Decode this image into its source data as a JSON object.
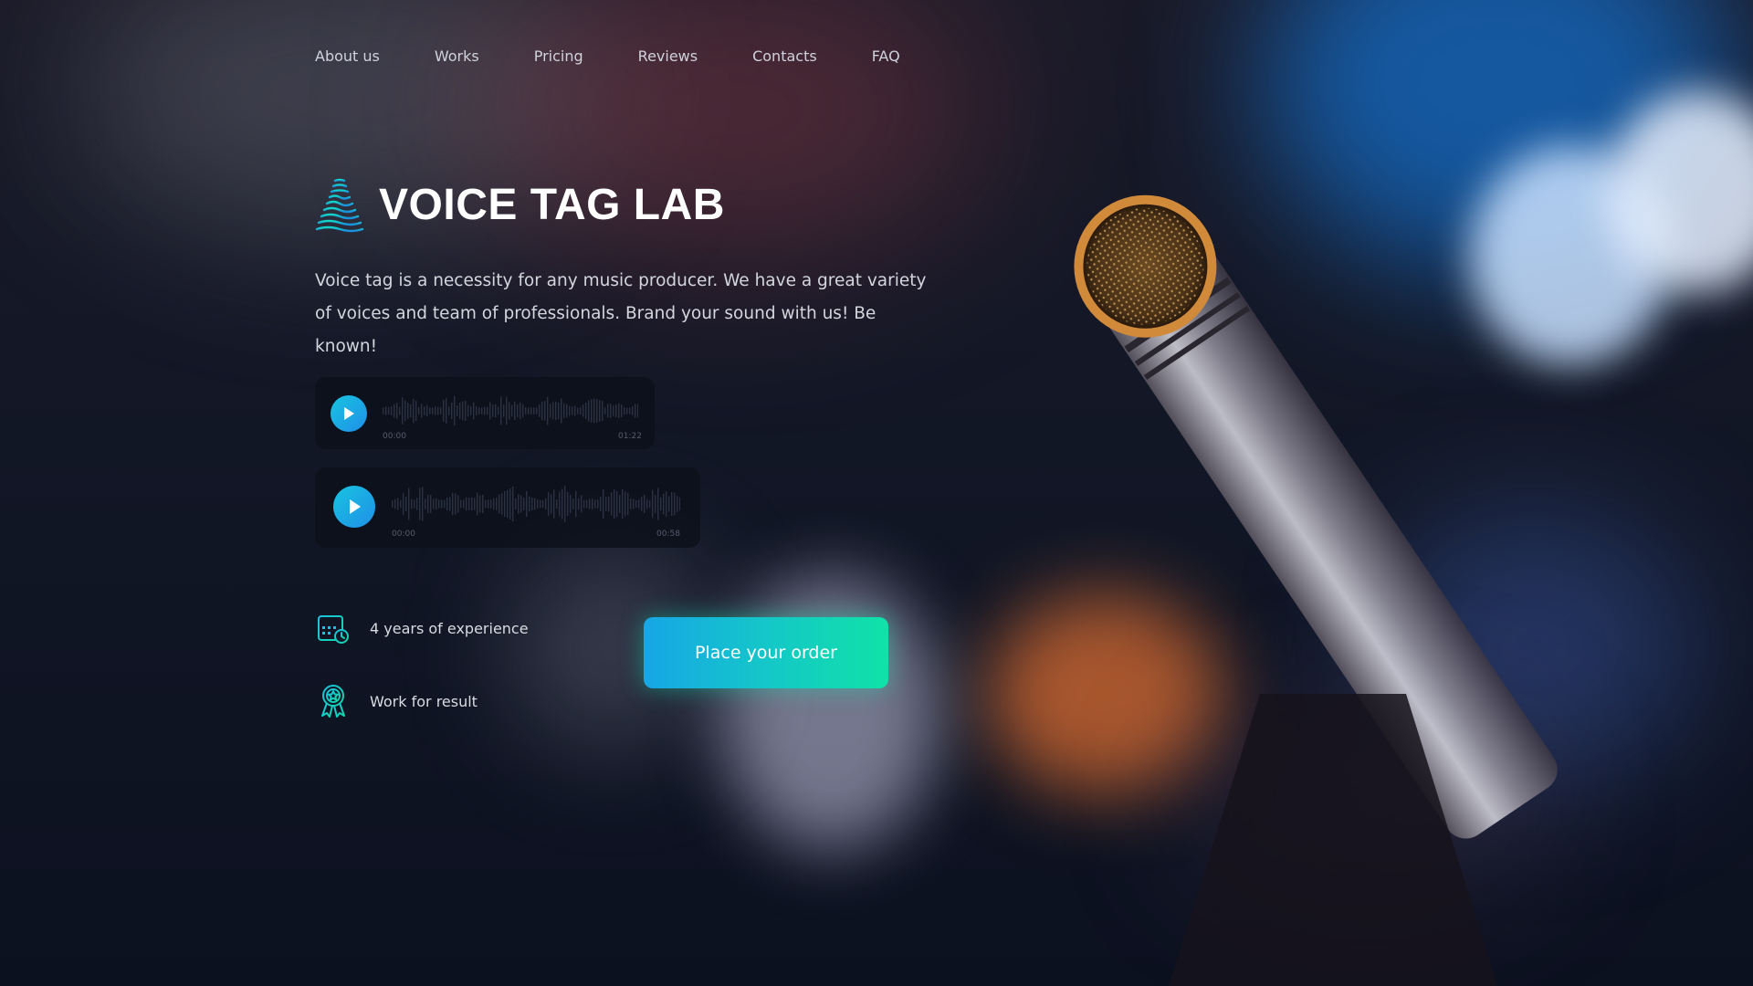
{
  "nav": {
    "items": [
      {
        "label": "About us"
      },
      {
        "label": "Works"
      },
      {
        "label": "Pricing"
      },
      {
        "label": "Reviews"
      },
      {
        "label": "Contacts"
      },
      {
        "label": "FAQ"
      }
    ]
  },
  "hero": {
    "title": "VOICE TAG LAB",
    "tagline": "Voice tag is a necessity for any music producer. We have a great variety of voices and team of professionals. Brand your sound with us! Be known!",
    "logo_icon": "sound-wave-icon"
  },
  "players": [
    {
      "start_time": "00:00",
      "end_time": "01:22",
      "icon": "play-icon"
    },
    {
      "start_time": "00:00",
      "end_time": "00:58",
      "icon": "play-icon"
    }
  ],
  "features": [
    {
      "label": "4 years of experience",
      "icon": "calendar-clock-icon"
    },
    {
      "label": "Work for result",
      "icon": "award-ribbon-icon"
    }
  ],
  "cta": {
    "label": "Place your order"
  },
  "colors": {
    "accent_start": "#17a6e6",
    "accent_end": "#10e2a7",
    "background": "#0d1220",
    "text": "#d4d6de"
  }
}
